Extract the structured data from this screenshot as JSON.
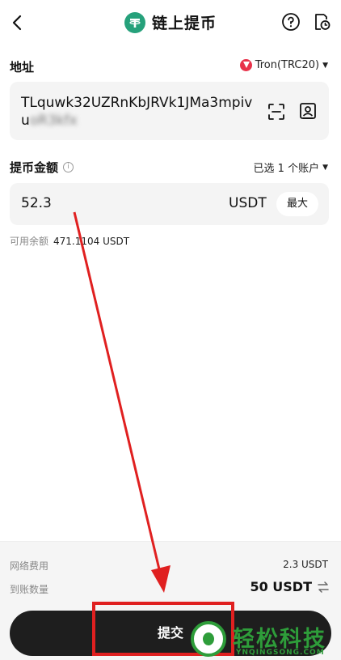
{
  "header": {
    "title": "链上提币",
    "back_icon": "chevron-left-icon",
    "help_icon": "question-circle-icon",
    "history_icon": "history-icon"
  },
  "address": {
    "label": "地址",
    "network": "Tron(TRC20)",
    "value_line1": "TLquwk32UZRnKbJRVk1JMa3mpiv",
    "value_line2_visible": "u",
    "value_line2_blurred": "oR3kfx"
  },
  "amount": {
    "label": "提币金额",
    "account_selector": "已选 1 个账户",
    "value": "52.3",
    "unit": "USDT",
    "max_label": "最大"
  },
  "balance": {
    "label": "可用余额",
    "value": "471.1104 USDT"
  },
  "summary": {
    "fee_label": "网络费用",
    "fee_value": "2.3 USDT",
    "receive_label": "到账数量",
    "receive_value": "50 USDT"
  },
  "submit_label": "提交",
  "watermark": {
    "title": "轻松科技",
    "subtitle": "YNQINGSONG.COM"
  },
  "colors": {
    "tether_green": "#26a17b",
    "tron_red": "#e8324a",
    "annotation_red": "#e02020",
    "button_dark": "#1e1e1e"
  }
}
